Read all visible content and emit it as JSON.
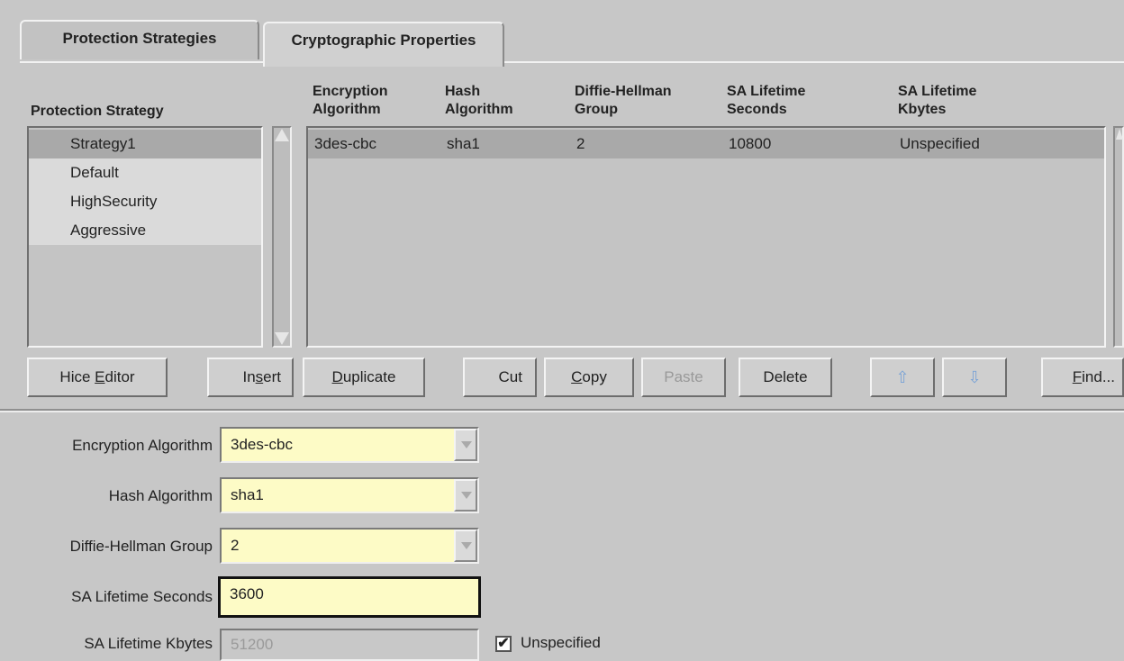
{
  "tabs": [
    {
      "label": "Protection Strategies"
    },
    {
      "label": "Cryptographic Properties"
    }
  ],
  "strategy_list": {
    "header": "Protection Strategy",
    "items": [
      "Strategy1",
      "Default",
      "HighSecurity",
      "Aggressive"
    ],
    "selected_index": 0
  },
  "properties_table": {
    "headers": [
      {
        "line1": "Encryption",
        "line2": "Algorithm"
      },
      {
        "line1": "Hash",
        "line2": "Algorithm"
      },
      {
        "line1": "Diffie-Hellman",
        "line2": "Group"
      },
      {
        "line1": "SA Lifetime",
        "line2": "Seconds"
      },
      {
        "line1": "SA Lifetime",
        "line2": "Kbytes"
      }
    ],
    "rows": [
      [
        "3des-cbc",
        "sha1",
        "2",
        "10800",
        "Unspecified"
      ]
    ]
  },
  "toolbar": {
    "hice_editor": {
      "pre": "Hice ",
      "u": "E",
      "post": "ditor"
    },
    "insert": {
      "pre": "In",
      "u": "s",
      "post": "ert"
    },
    "duplicate": {
      "pre": "",
      "u": "D",
      "post": "uplicate"
    },
    "cut": "Cut",
    "copy": {
      "pre": "",
      "u": "C",
      "post": "opy"
    },
    "paste": "Paste",
    "delete": "Delete",
    "find": {
      "pre": "",
      "u": "F",
      "post": "ind..."
    }
  },
  "form": {
    "encryption_label": "Encryption Algorithm",
    "encryption_value": "3des-cbc",
    "hash_label": "Hash Algorithm",
    "hash_value": "sha1",
    "dh_label": "Diffie-Hellman Group",
    "dh_value": "2",
    "sa_seconds_label": "SA Lifetime Seconds",
    "sa_seconds_value": "3600",
    "sa_kbytes_label": "SA Lifetime Kbytes",
    "sa_kbytes_value": "51200",
    "unspecified_label": "Unspecified",
    "unspecified_checked": true
  },
  "colors": {
    "background": "#c7c7c7",
    "field_bg": "#fdfbc6",
    "selected_row": "#a9a9a9"
  }
}
